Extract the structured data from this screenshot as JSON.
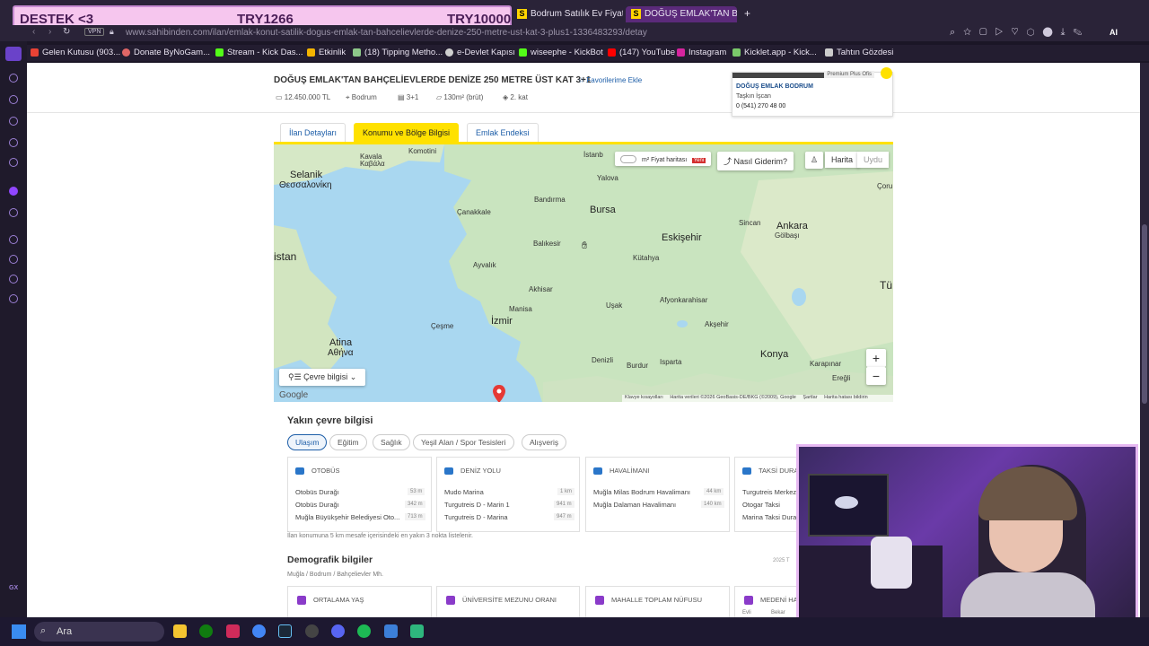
{
  "overlay": {
    "left": "DESTEK <3",
    "mid": "TRY1266",
    "right": "TRY10000"
  },
  "tabs": [
    {
      "label": "Bodrum Satılık Ev Fiyatları"
    },
    {
      "label": "DOĞUŞ EMLAK'TAN BAHÇ"
    }
  ],
  "url": "www.sahibinden.com/ilan/emlak-konut-satilik-dogus-emlak-tan-bahcelievlerde-denize-250-metre-ust-kat-3-plus1-1336483293/detay",
  "vpn": "VPN",
  "bookmarks": [
    "Gelen Kutusu (903...",
    "Donate ByNoGam...",
    "Stream - Kick Das...",
    "Etkinlik",
    "(18) Tipping Metho...",
    "e-Devlet Kapısı",
    "wiseephe - KickBot",
    "(147) YouTube",
    "Instagram",
    "Kicklet.app - Kick...",
    "Tahtın Gözdesi"
  ],
  "listing": {
    "title": "DOĞUŞ EMLAK'TAN BAHÇELİEVLERDE DENİZE 250 METRE ÜST KAT 3+1",
    "fav": "Favorilerime Ekle",
    "price": "12.450.000 TL",
    "location": "Bodrum",
    "rooms": "3+1",
    "area": "130m² (brüt)",
    "floor": "2. kat"
  },
  "contact": {
    "badge": "Premium Plus Ofis",
    "name": "DOĞUŞ EMLAK BODRUM",
    "person": "Taşkın İşcan",
    "phone": "0 (541) 270 48 00"
  },
  "page_tabs": [
    "İlan Detayları",
    "Konumu ve Bölge Bilgisi",
    "Emlak Endeksi"
  ],
  "map": {
    "toggle_label": "m² Fiyat haritası",
    "new_badge": "Yeni",
    "directions": "Nasıl Giderim?",
    "map_type": "Harita",
    "satellite": "Uydu",
    "env_btn": "Çevre bilgisi",
    "zoom_in": "+",
    "zoom_out": "−",
    "google": "Google",
    "footer": [
      "Klavye kısayolları",
      "Harita verileri ©2026 GeoBasis-DE/BKG (©2009), Google",
      "Şartlar",
      "Harita hatası bildirin"
    ],
    "labels": {
      "selanik": "Selanik",
      "selanik_gr": "Θεσσαλονίκη",
      "kavala": "Kavala",
      "kavala_gr": "Καβάλα",
      "komotini": "Komotini",
      "istanbul": "İstanb",
      "bandirma": "Bandırma",
      "canakkale": "Çanakkale",
      "bursa": "Bursa",
      "yalova": "Yalova",
      "balikesir": "Balıkesir",
      "eskisehir": "Eskişehir",
      "ankara": "Ankara",
      "golbasi": "Gölbaşı",
      "sincan": "Sincan",
      "corum": "Çoru",
      "istan": "istan",
      "ayvalik": "Ayvalık",
      "kutahya": "Kütahya",
      "akhisar": "Akhisar",
      "manisa": "Manisa",
      "izmir": "İzmir",
      "cesme": "Çeşme",
      "usak": "Uşak",
      "afyon": "Afyonkarahisar",
      "aksehir": "Akşehir",
      "tu": "Tü",
      "atina": "Atina",
      "atina_gr": "Αθήνα",
      "denizli": "Denizli",
      "isparta": "Isparta",
      "burdur": "Burdur",
      "konya": "Konya",
      "karapinar": "Karapınar",
      "eregli": "Ereğli"
    }
  },
  "nearby": {
    "title": "Yakın çevre bilgisi",
    "chips": [
      "Ulaşım",
      "Eğitim",
      "Sağlık",
      "Yeşil Alan / Spor Tesisleri",
      "Alışveriş"
    ],
    "cards": [
      {
        "title": "OTOBÜS",
        "rows": [
          [
            "Otobüs Durağı",
            "53 m"
          ],
          [
            "Otobüs Durağı",
            "342 m"
          ],
          [
            "Muğla Büyükşehir Belediyesi Oto...",
            "713 m"
          ]
        ]
      },
      {
        "title": "DENİZ YOLU",
        "rows": [
          [
            "Mudo Marina",
            "1 km"
          ],
          [
            "Turgutreis D - Marin 1",
            "941 m"
          ],
          [
            "Turgutreis D - Marina",
            "947 m"
          ]
        ]
      },
      {
        "title": "HAVALİMANI",
        "rows": [
          [
            "Muğla Milas Bodrum Havalimanı",
            "44 km"
          ],
          [
            "Muğla Dalaman Havalimanı",
            "140 km"
          ]
        ]
      },
      {
        "title": "TAKSİ DURA",
        "rows": [
          [
            "Turgutreis Merkez",
            ""
          ],
          [
            "Otogar Taksi",
            ""
          ],
          [
            "Marina Taksi Dura",
            ""
          ]
        ]
      }
    ],
    "note": "İlan konumuna 5 km mesafe içerisindeki en yakın 3 nokta listelenir."
  },
  "demographics": {
    "title": "Demografik bilgiler",
    "sub": "Muğla / Bodrum / Bahçelievler Mh.",
    "year": "2025 T",
    "cards": [
      "ORTALAMA YAŞ",
      "ÜNİVERSİTE MEZUNU ORANI",
      "MAHALLE TOPLAM NÜFUSU",
      "MEDENİ HA"
    ],
    "extra": [
      "Evli",
      "Bekar"
    ]
  },
  "taskbar": {
    "search_placeholder": "Ara"
  },
  "sidebar_extra": "GX"
}
